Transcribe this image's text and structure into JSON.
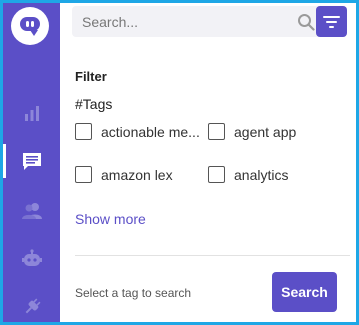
{
  "colors": {
    "accent": "#5b4fc7",
    "border": "#1ea7e6",
    "sidebar_icon": "#8d86d9"
  },
  "sidebar": {
    "logo_icon": "chat-bubble-logo-icon",
    "items": [
      {
        "icon": "bar-chart-icon",
        "active": false
      },
      {
        "icon": "chat-list-icon",
        "active": true
      },
      {
        "icon": "users-icon",
        "active": false
      },
      {
        "icon": "bot-icon",
        "active": false
      },
      {
        "icon": "integrations-plug-icon",
        "active": false
      }
    ]
  },
  "search": {
    "placeholder": "Search...",
    "value": ""
  },
  "filter": {
    "title": "Filter",
    "tags_label": "#Tags",
    "tags": [
      {
        "label": "actionable me...",
        "checked": false
      },
      {
        "label": "agent app",
        "checked": false
      },
      {
        "label": "amazon lex",
        "checked": false
      },
      {
        "label": "analytics",
        "checked": false
      }
    ],
    "show_more": "Show more"
  },
  "footer": {
    "hint": "Select a tag to search",
    "search_button": "Search"
  }
}
